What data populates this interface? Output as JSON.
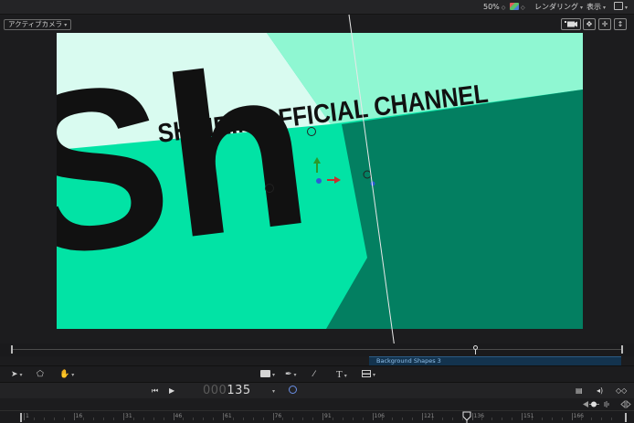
{
  "topbar": {
    "zoom": "50%",
    "render_menu": "レンダリング",
    "view_menu": "表示"
  },
  "canvas_header": {
    "camera_menu": "アクティブカメラ"
  },
  "canvas": {
    "title_text": "SHINRIN OFFICIAL CHANNEL",
    "big_letters": "Sh",
    "colors": {
      "mint_bright": "#02e3a5",
      "mint_light": "#8ff7d2",
      "mint_pale": "#d9fbf0",
      "teal_dark": "#037f61",
      "text": "#111111"
    }
  },
  "timeline": {
    "clip_label": "Background Shapes 3"
  },
  "transport": {
    "timecode_dim": "000",
    "timecode_lit": "135"
  },
  "ruler": {
    "labels": [
      "1",
      "16",
      "31",
      "46",
      "61",
      "76",
      "91",
      "106",
      "121",
      "136",
      "151",
      "166"
    ]
  },
  "icons": {
    "arrow": "select-arrow-icon",
    "hand": "hand-pan-icon",
    "shape": "rectangle-shape-icon",
    "pen": "bezier-pen-icon",
    "brush": "paint-stroke-icon",
    "text": "text-tool-icon",
    "mask": "mask-icon"
  }
}
